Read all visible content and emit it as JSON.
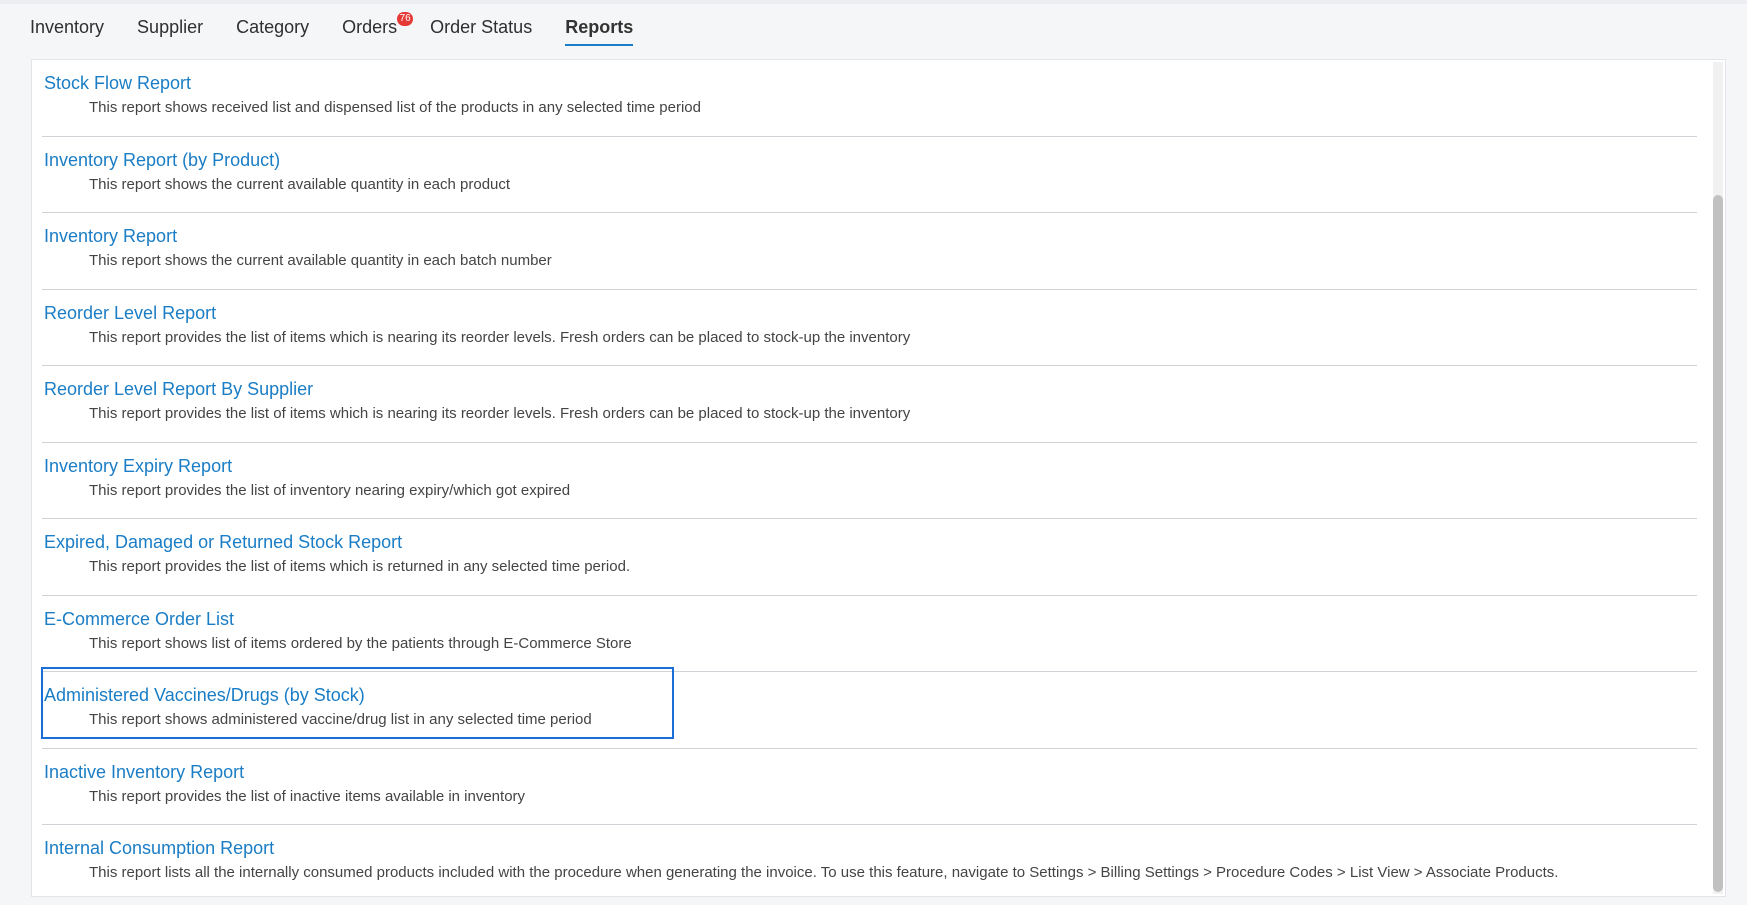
{
  "tabs": [
    {
      "label": "Inventory",
      "active": false
    },
    {
      "label": "Supplier",
      "active": false
    },
    {
      "label": "Category",
      "active": false
    },
    {
      "label": "Orders",
      "active": false,
      "badge": "76"
    },
    {
      "label": "Order Status",
      "active": false
    },
    {
      "label": "Reports",
      "active": true
    }
  ],
  "reports": [
    {
      "title": "Stock Flow Report",
      "description": "This report shows received list and dispensed list of the products in any selected time period"
    },
    {
      "title": "Inventory Report (by Product)",
      "description": "This report shows the current available quantity in each product"
    },
    {
      "title": "Inventory Report",
      "description": "This report shows the current available quantity in each batch number"
    },
    {
      "title": "Reorder Level Report",
      "description": "This report provides the list of items which is nearing its reorder levels. Fresh orders can be placed to stock-up the inventory"
    },
    {
      "title": "Reorder Level Report By Supplier",
      "description": "This report provides the list of items which is nearing its reorder levels. Fresh orders can be placed to stock-up the inventory"
    },
    {
      "title": "Inventory Expiry Report",
      "description": "This report provides the list of inventory nearing expiry/which got expired"
    },
    {
      "title": "Expired, Damaged or Returned Stock Report",
      "description": "This report provides the list of items which is returned in any selected time period."
    },
    {
      "title": "E-Commerce Order List",
      "description": "This report shows list of items ordered by the patients through E-Commerce Store"
    },
    {
      "title": "Administered Vaccines/Drugs (by Stock)",
      "description": "This report shows administered vaccine/drug list in any selected time period"
    },
    {
      "title": "Inactive Inventory Report",
      "description": "This report provides the list of inactive items available in inventory"
    },
    {
      "title": "Internal Consumption Report",
      "description": "This report lists all the internally consumed products included with the procedure when generating the invoice. To use this feature, navigate to Settings > Billing Settings > Procedure Codes > List View > Associate Products."
    }
  ],
  "colors": {
    "link": "#1a7dc5",
    "badge": "#e53935",
    "highlight": "#1a6fd6"
  }
}
